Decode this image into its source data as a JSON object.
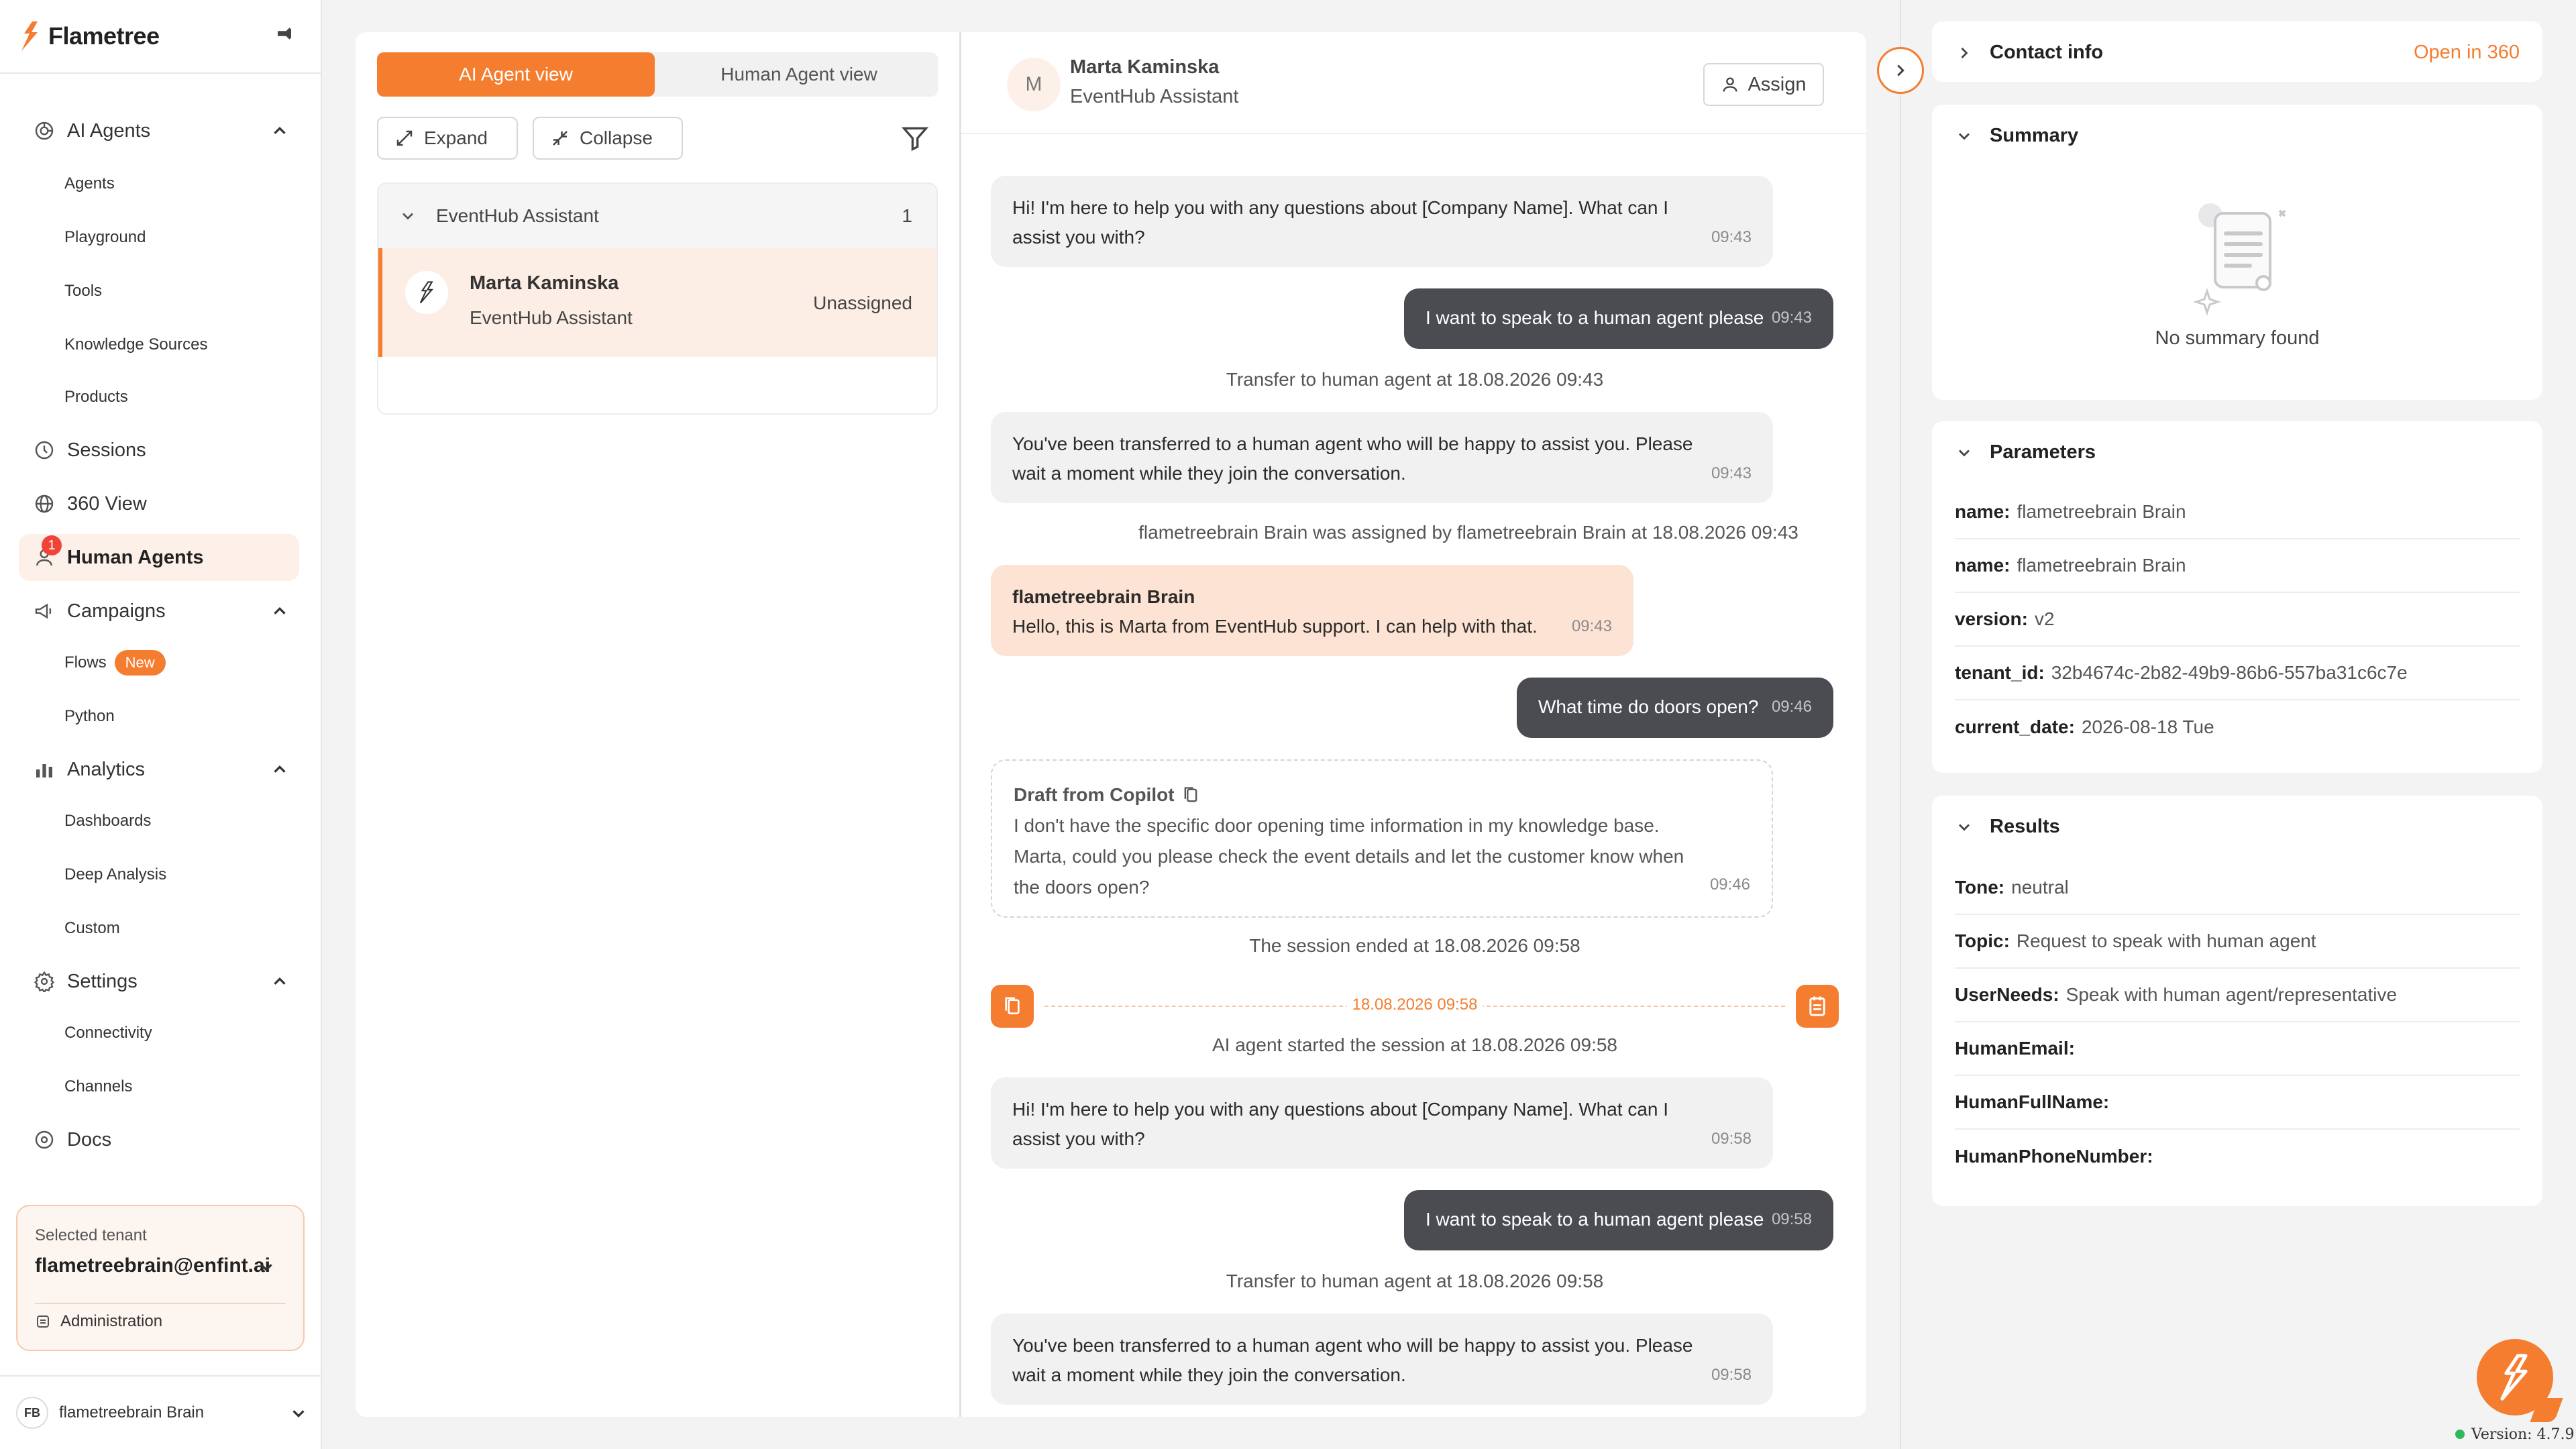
{
  "brand": {
    "name": "Flametree",
    "accent": "#f47d30"
  },
  "sidebar": {
    "sections": [
      {
        "label": "AI Agents",
        "icon": "ai-agents-icon",
        "expanded": true,
        "children": [
          "Agents",
          "Playground",
          "Tools",
          "Knowledge Sources",
          "Products"
        ]
      },
      {
        "label": "Sessions",
        "icon": "sessions-icon"
      },
      {
        "label": "360 View",
        "icon": "globe-icon"
      },
      {
        "label": "Human Agents",
        "icon": "human-agent-icon",
        "active": true,
        "badge": "1"
      },
      {
        "label": "Campaigns",
        "icon": "megaphone-icon",
        "expanded": true,
        "children": [
          "Flows",
          "Python"
        ],
        "new_badge": "New"
      },
      {
        "label": "Analytics",
        "icon": "analytics-icon",
        "expanded": true,
        "children": [
          "Dashboards",
          "Deep Analysis",
          "Custom"
        ]
      },
      {
        "label": "Settings",
        "icon": "gear-icon",
        "expanded": true,
        "children": [
          "Connectivity",
          "Channels"
        ]
      },
      {
        "label": "Docs",
        "icon": "docs-icon"
      }
    ],
    "tenant": {
      "label": "Selected tenant",
      "value": "flametreebrain@enfint.ai",
      "admin": "Administration"
    },
    "user": {
      "initials": "FB",
      "name": "flametreebrain Brain"
    }
  },
  "list": {
    "tabs": [
      "AI Agent view",
      "Human Agent view"
    ],
    "expand": "Expand",
    "collapse": "Collapse",
    "group": {
      "name": "EventHub Assistant",
      "count": "1"
    },
    "item": {
      "name": "Marta Kaminska",
      "agent": "EventHub Assistant",
      "status": "Unassigned"
    }
  },
  "chat": {
    "header": {
      "initial": "M",
      "name": "Marta Kaminska",
      "agent": "EventHub Assistant",
      "assign": "Assign"
    },
    "messages": [
      {
        "kind": "ai",
        "text": "Hi! I'm here to help you with any questions about [Company Name]. What can I assist you with?",
        "time": "09:43"
      },
      {
        "kind": "user",
        "text": "I want to speak to a human agent please",
        "time": "09:43"
      },
      {
        "kind": "system",
        "text": "Transfer to human agent at 18.08.2026 09:43"
      },
      {
        "kind": "ai",
        "text": "You've been transferred to a human agent who will be happy to assist you. Please wait a moment while they join the conversation.",
        "time": "09:43"
      },
      {
        "kind": "system",
        "text": "flametreebrain Brain was assigned by flametreebrain Brain at 18.08.2026 09:43"
      },
      {
        "kind": "agent",
        "author": "flametreebrain Brain",
        "text": "Hello, this is Marta from EventHub support. I can help with that.",
        "time": "09:43"
      },
      {
        "kind": "user",
        "text": "What time do doors open?",
        "time": "09:46"
      },
      {
        "kind": "draft",
        "title": "Draft from Copilot",
        "text": "I don't have the specific door opening time information in my knowledge base. Marta, could you please check the event details and let the customer know when the doors open?",
        "time": "09:46"
      },
      {
        "kind": "system",
        "text": "The session ended at 18.08.2026 09:58"
      },
      {
        "kind": "separator",
        "text": "18.08.2026 09:58"
      },
      {
        "kind": "system",
        "text": "AI agent started the session at 18.08.2026 09:58"
      },
      {
        "kind": "ai",
        "text": "Hi! I'm here to help you with any questions about [Company Name]. What can I assist you with?",
        "time": "09:58"
      },
      {
        "kind": "user",
        "text": "I want to speak to a human agent please",
        "time": "09:58"
      },
      {
        "kind": "system",
        "text": "Transfer to human agent at 18.08.2026 09:58"
      },
      {
        "kind": "ai",
        "text": "You've been transferred to a human agent who will be happy to assist you. Please wait a moment while they join the conversation.",
        "time": "09:58"
      }
    ]
  },
  "right": {
    "contact": {
      "title": "Contact info",
      "link": "Open in 360"
    },
    "summary": {
      "title": "Summary",
      "empty": "No summary found"
    },
    "parameters": {
      "title": "Parameters",
      "rows": [
        {
          "k": "name:",
          "v": "flametreebrain Brain"
        },
        {
          "k": "name:",
          "v": "flametreebrain Brain"
        },
        {
          "k": "version:",
          "v": "v2"
        },
        {
          "k": "tenant_id:",
          "v": "32b4674c-2b82-49b9-86b6-557ba31c6c7e"
        },
        {
          "k": "current_date:",
          "v": "2026-08-18 Tue"
        }
      ]
    },
    "results": {
      "title": "Results",
      "rows": [
        {
          "k": "Tone:",
          "v": "neutral"
        },
        {
          "k": "Topic:",
          "v": "Request to speak with human agent"
        },
        {
          "k": "UserNeeds:",
          "v": "Speak with human agent/representative"
        },
        {
          "k": "HumanEmail:",
          "v": ""
        },
        {
          "k": "HumanFullName:",
          "v": ""
        },
        {
          "k": "HumanPhoneNumber:",
          "v": ""
        }
      ]
    }
  },
  "version": "Version: 4.7.9"
}
